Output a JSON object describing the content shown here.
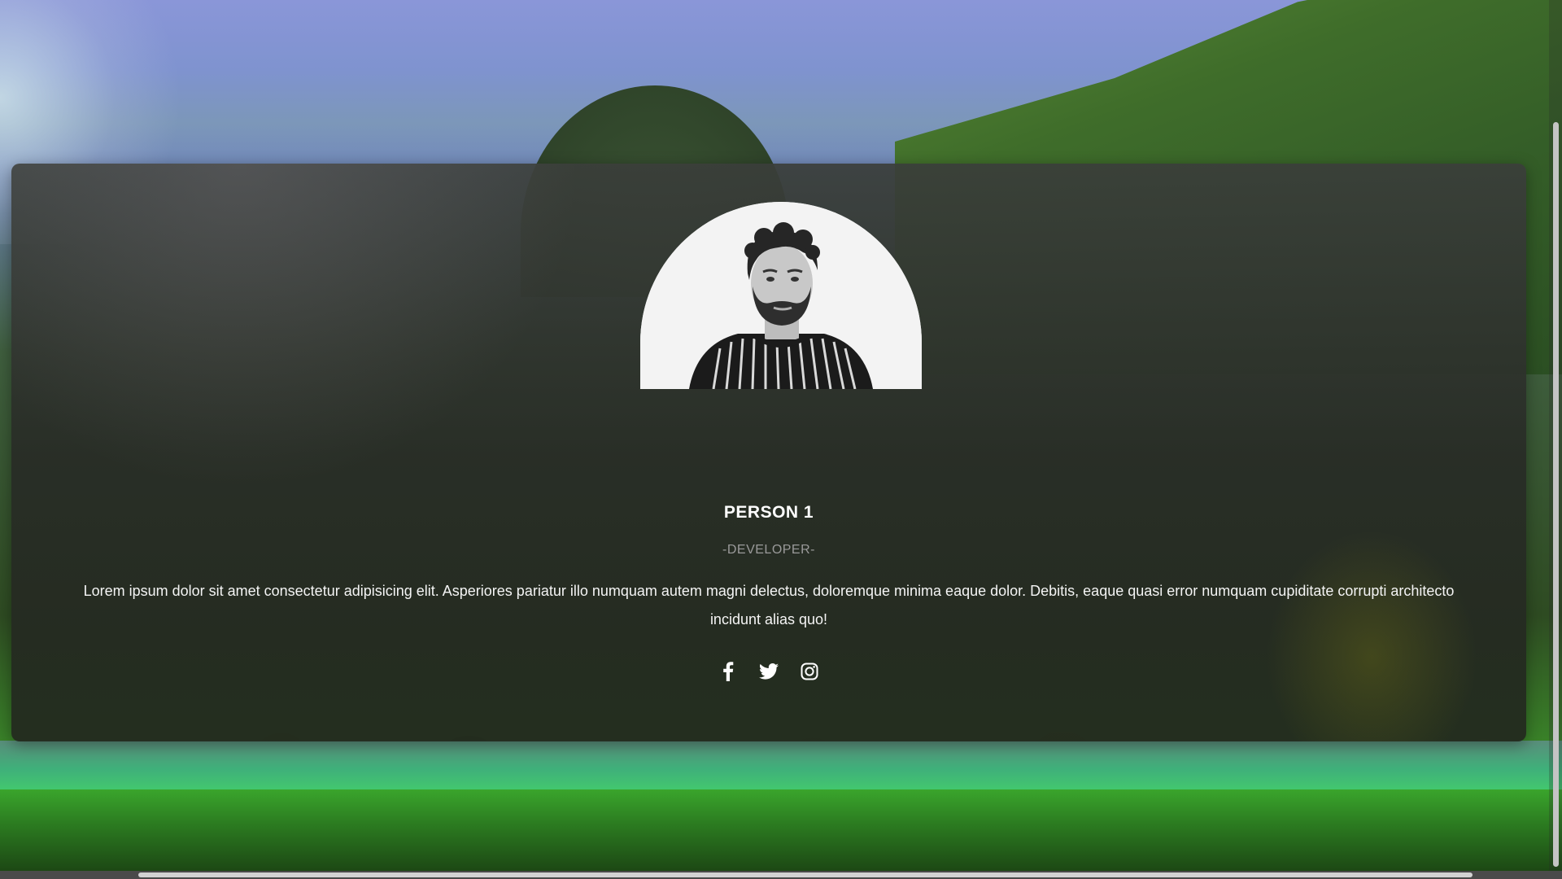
{
  "profile": {
    "name": "PERSON 1",
    "role": "-DEVELOPER-",
    "bio": "Lorem ipsum dolor sit amet consectetur adipisicing elit. Asperiores pariatur illo numquam autem magni delectus, doloremque minima eaque dolor. Debitis, eaque quasi error numquam cupiditate corrupti architecto incidunt alias quo!"
  },
  "socials": [
    {
      "icon": "facebook-icon"
    },
    {
      "icon": "twitter-icon"
    },
    {
      "icon": "instagram-icon"
    }
  ],
  "colors": {
    "text": "#ffffff",
    "role": "#9a9a9a",
    "card": "#2e332c"
  }
}
